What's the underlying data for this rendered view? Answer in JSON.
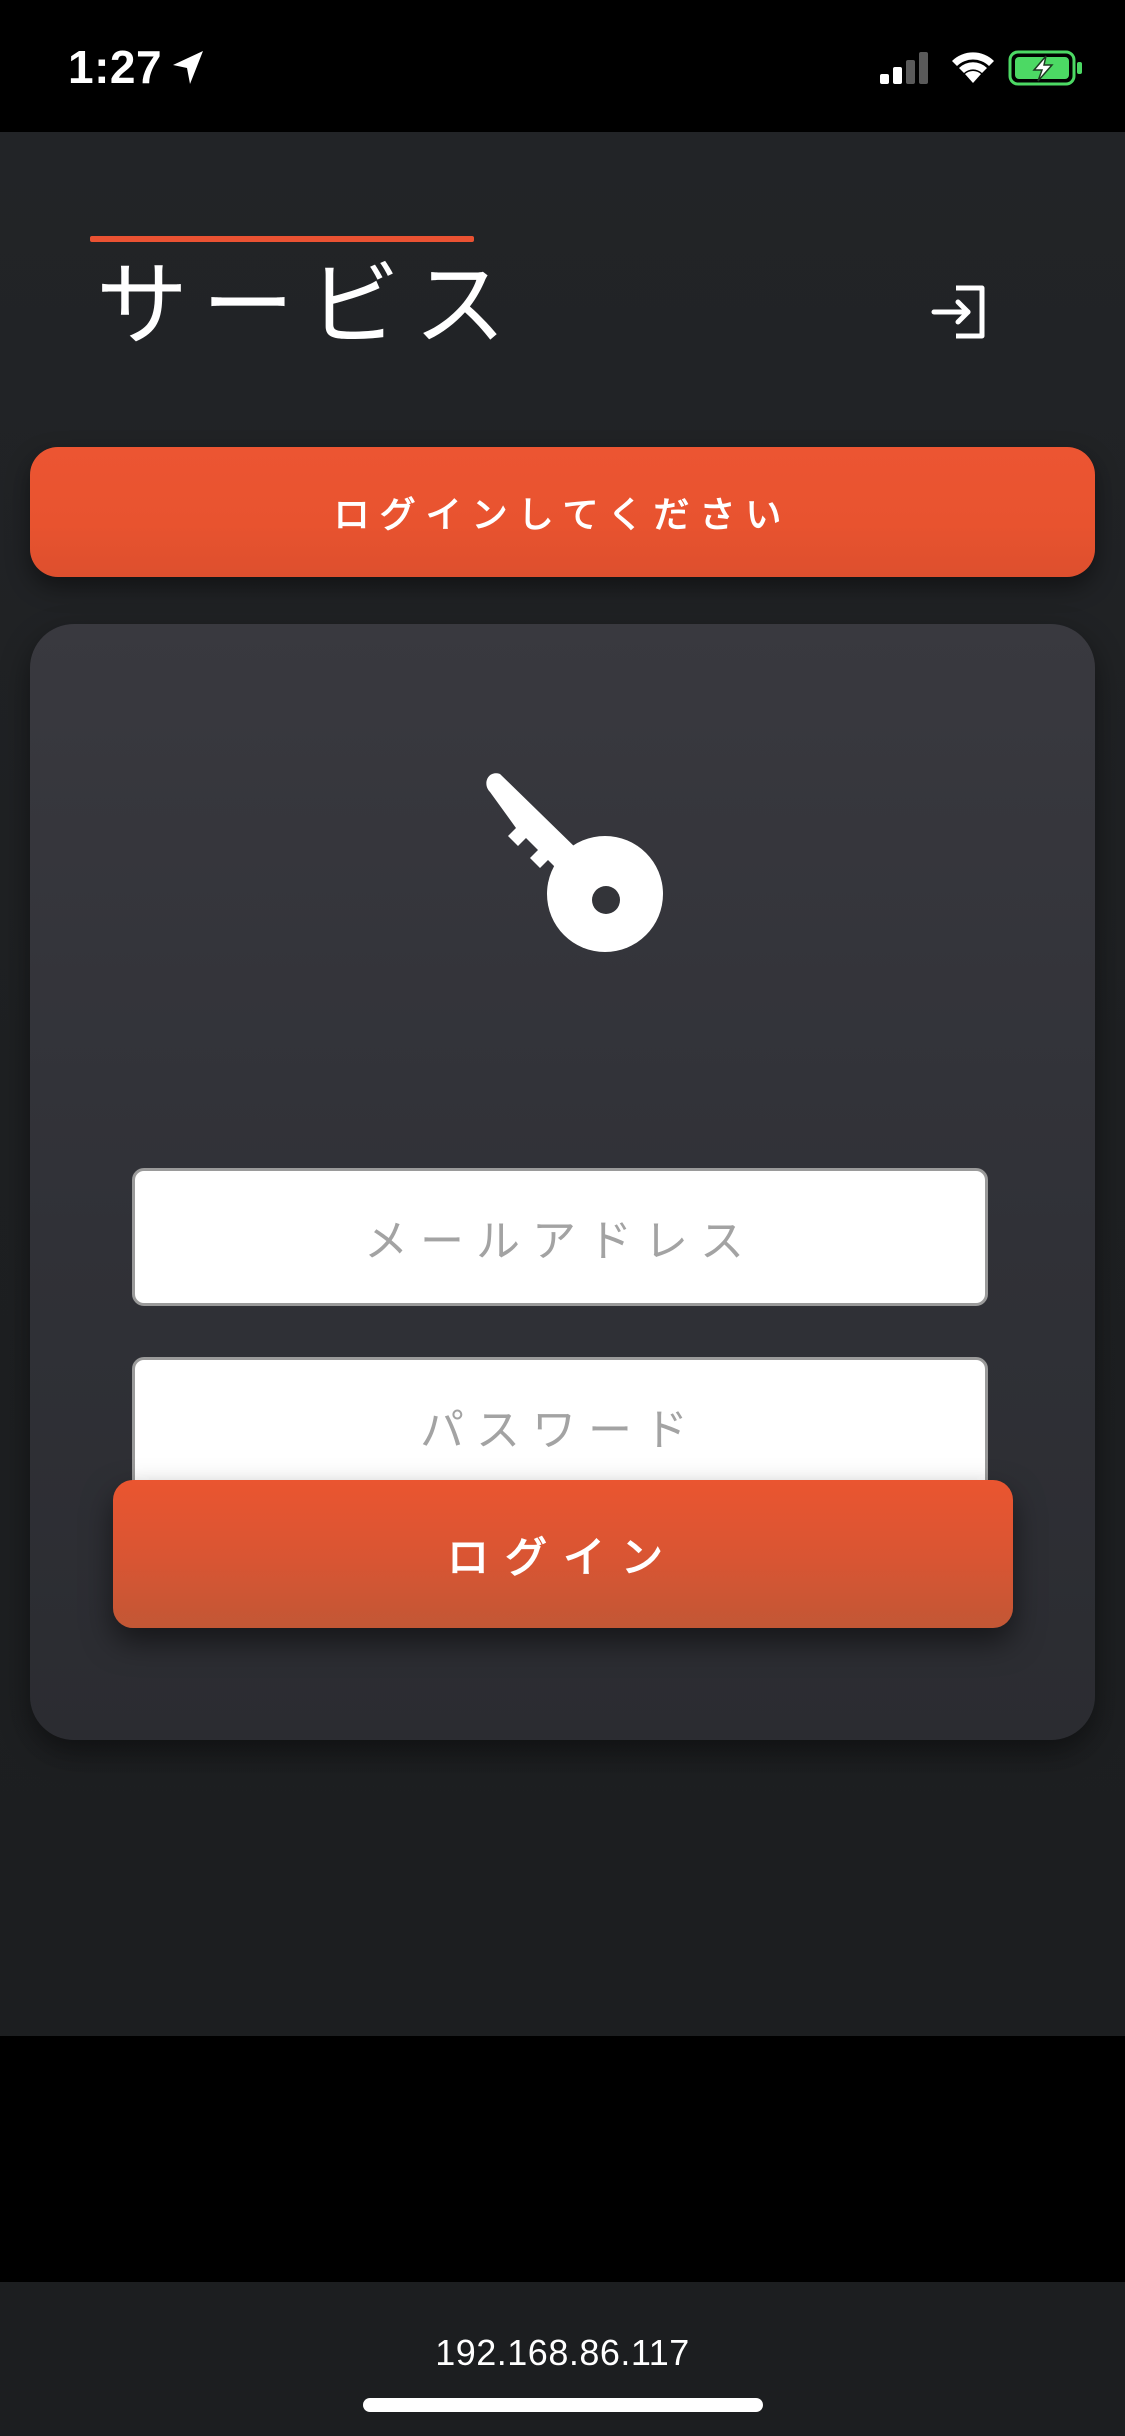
{
  "status_bar": {
    "time": "1:27",
    "icons": [
      "location-arrow-icon",
      "cellular-signal-icon",
      "wifi-icon",
      "battery-charging-icon"
    ],
    "battery_color": "#4cd964"
  },
  "header": {
    "title": "サービス",
    "accent_color": "#ea5232",
    "login_icon": "login-arrow-icon"
  },
  "banner": {
    "text": "ログインしてください",
    "color": "#ea5232"
  },
  "login_card": {
    "icon": "key-icon",
    "email": {
      "value": "",
      "placeholder": "メールアドレス"
    },
    "password": {
      "value": "",
      "placeholder": "パスワード"
    },
    "submit_label": "ログイン"
  },
  "browser_bar": {
    "address": "192.168.86.117"
  }
}
